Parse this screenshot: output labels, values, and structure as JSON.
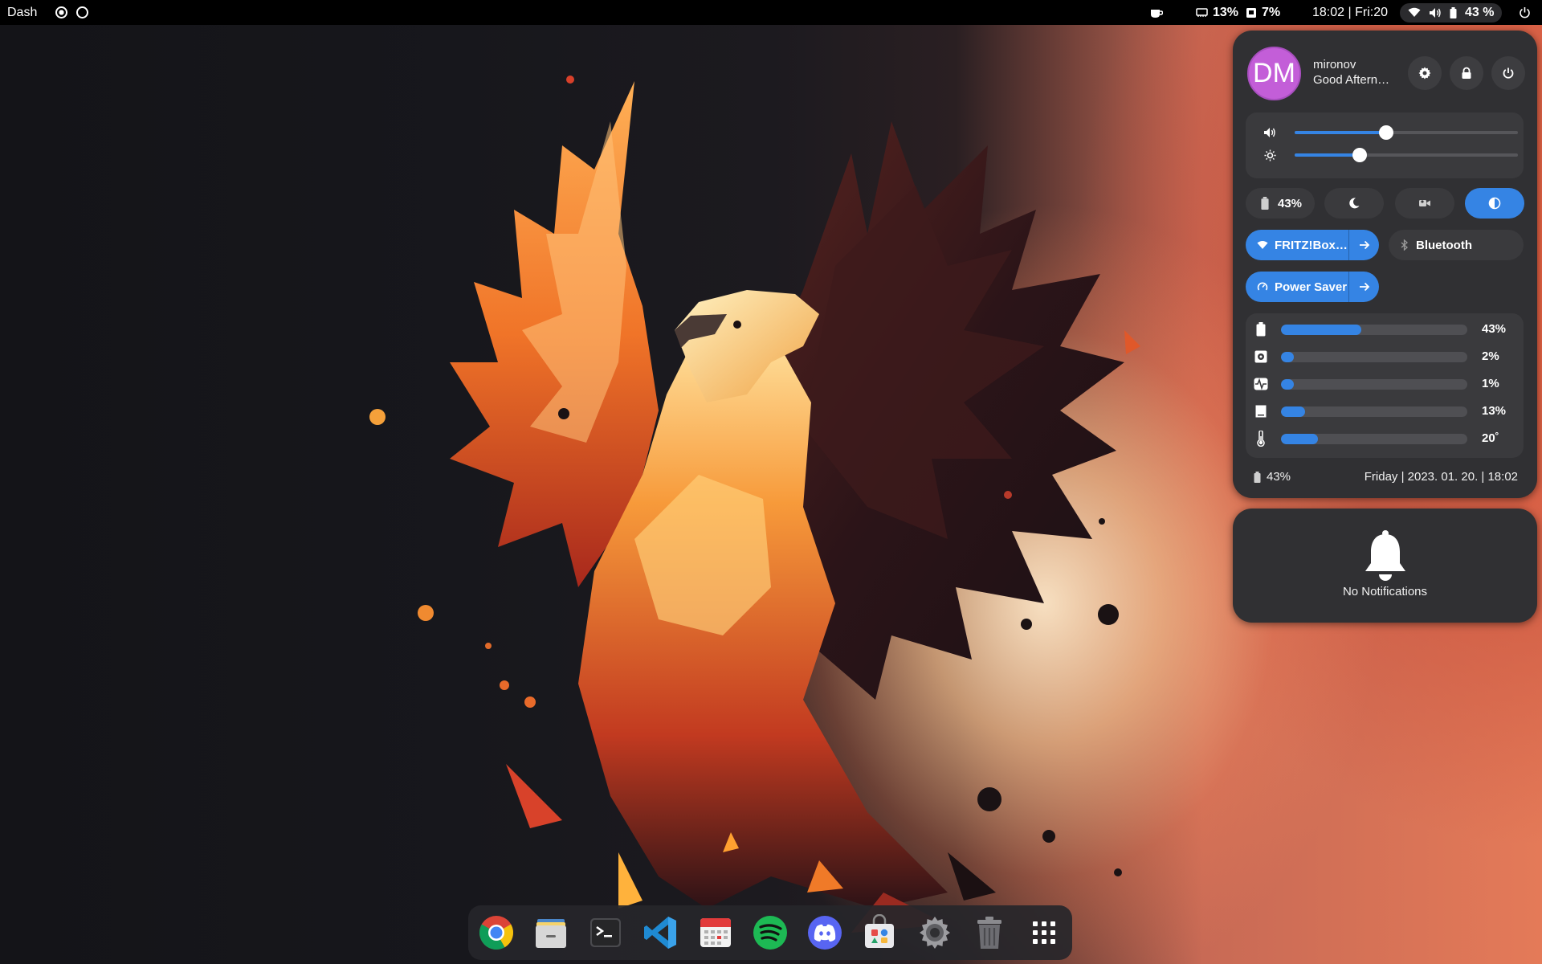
{
  "topbar": {
    "activities_label": "Dash",
    "workspaces": [
      "workspace-1",
      "workspace-2"
    ],
    "gpu_value": "13%",
    "ram_value": "7%",
    "clock": "18:02 | Fri:20",
    "battery_label": "43 %"
  },
  "quick_settings": {
    "user": {
      "initials": "DM",
      "name": "mironov",
      "greeting": "Good Afternoon!"
    },
    "sliders": {
      "volume": 0.41,
      "brightness": 0.29
    },
    "battery_pill": "43%",
    "wifi_label": "FRITZ!Box…",
    "bluetooth_label": "Bluetooth",
    "power_label": "Power Saver",
    "meters": [
      {
        "icon": "battery-icon",
        "value": "43%",
        "fraction": 0.43
      },
      {
        "icon": "disk-icon",
        "value": "2%",
        "fraction": 0.02
      },
      {
        "icon": "cpu-activity-icon",
        "value": "1%",
        "fraction": 0.01
      },
      {
        "icon": "memory-icon",
        "value": "13%",
        "fraction": 0.13
      },
      {
        "icon": "thermometer-icon",
        "value": "20˚",
        "fraction": 0.2
      }
    ],
    "footer_battery": "43%",
    "footer_date": "Friday | 2023. 01. 20. | 18:02"
  },
  "notifications": {
    "empty_label": "No Notifications"
  },
  "dock": {
    "apps": [
      "chrome-icon",
      "files-icon",
      "terminal-icon",
      "vscode-icon",
      "calendar-icon",
      "spotify-icon",
      "discord-icon",
      "software-store-icon",
      "settings-icon",
      "trash-icon",
      "app-grid-icon"
    ]
  },
  "colors": {
    "accent": "#3584e4",
    "avatar": "#c35ed8",
    "panel": "#303033",
    "topbar": "#000000"
  }
}
